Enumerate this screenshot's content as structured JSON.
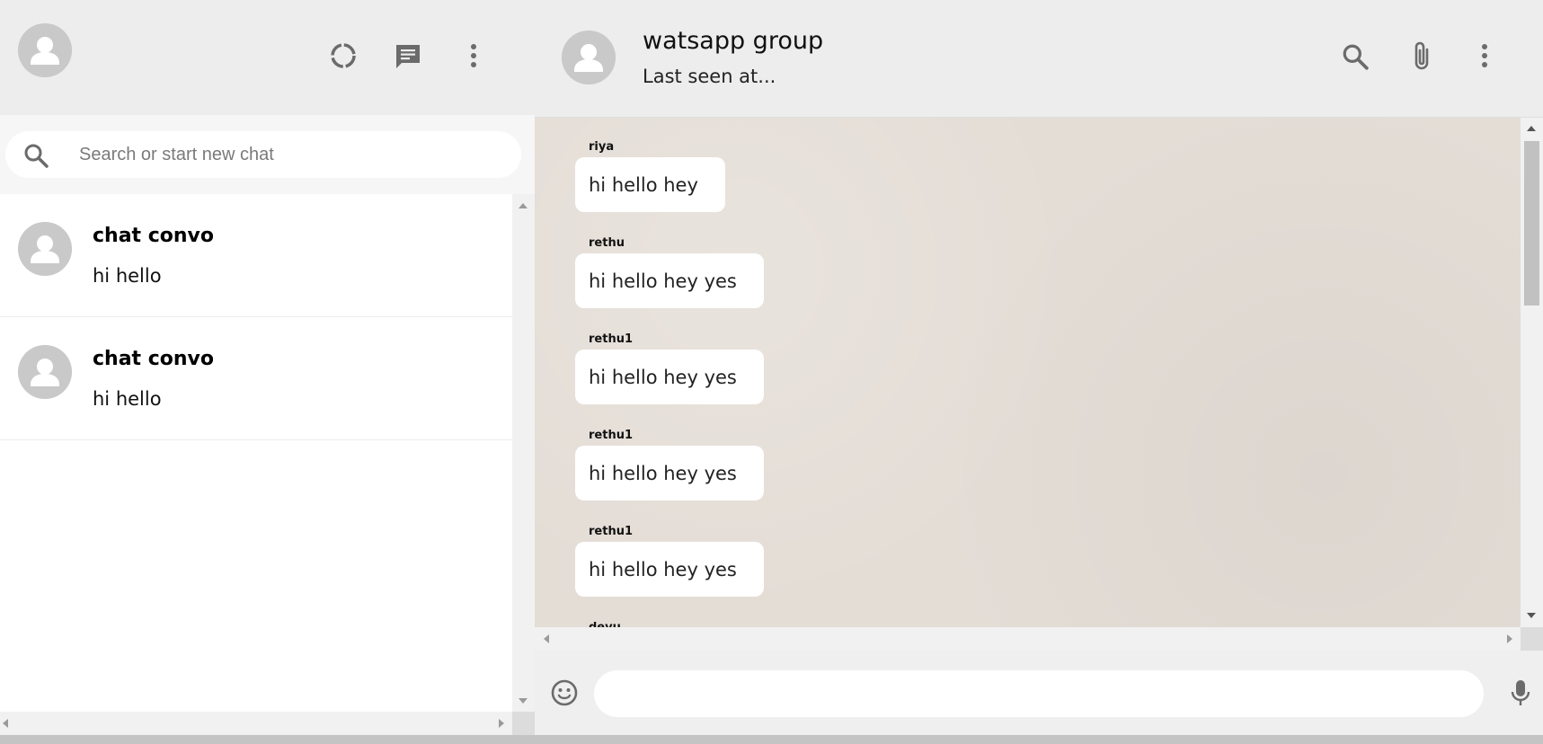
{
  "sidebar": {
    "header": {
      "avatar_icon": "user-avatar-icon",
      "status_icon": "status-ring-icon",
      "new_chat_icon": "chat-message-icon",
      "menu_icon": "vertical-dots-icon"
    },
    "search": {
      "placeholder": "Search or start new chat",
      "value": ""
    },
    "chats": [
      {
        "name": "chat convo",
        "last_message": "hi hello"
      },
      {
        "name": "chat convo",
        "last_message": "hi hello"
      }
    ]
  },
  "conversation": {
    "title": "watsapp group",
    "subtitle": "Last seen at...",
    "header_icons": [
      "search-icon",
      "paperclip-icon",
      "vertical-dots-icon"
    ],
    "messages": [
      {
        "sender": "riya",
        "text": "hi hello hey"
      },
      {
        "sender": "rethu",
        "text": "hi hello hey yes"
      },
      {
        "sender": "rethu1",
        "text": "hi hello hey yes"
      },
      {
        "sender": "rethu1",
        "text": "hi hello hey yes"
      },
      {
        "sender": "rethu1",
        "text": "hi hello hey yes"
      },
      {
        "sender": "devu",
        "text": ""
      }
    ],
    "composer": {
      "placeholder": "",
      "value": "",
      "emoji_icon": "emoji-icon",
      "mic_icon": "microphone-icon"
    }
  },
  "colors": {
    "header_bg": "#ededed",
    "chat_bg": "#e4ddd6",
    "bubble_bg": "#ffffff",
    "icon_gray": "#777777",
    "avatar_gray": "#c9c9c9"
  }
}
